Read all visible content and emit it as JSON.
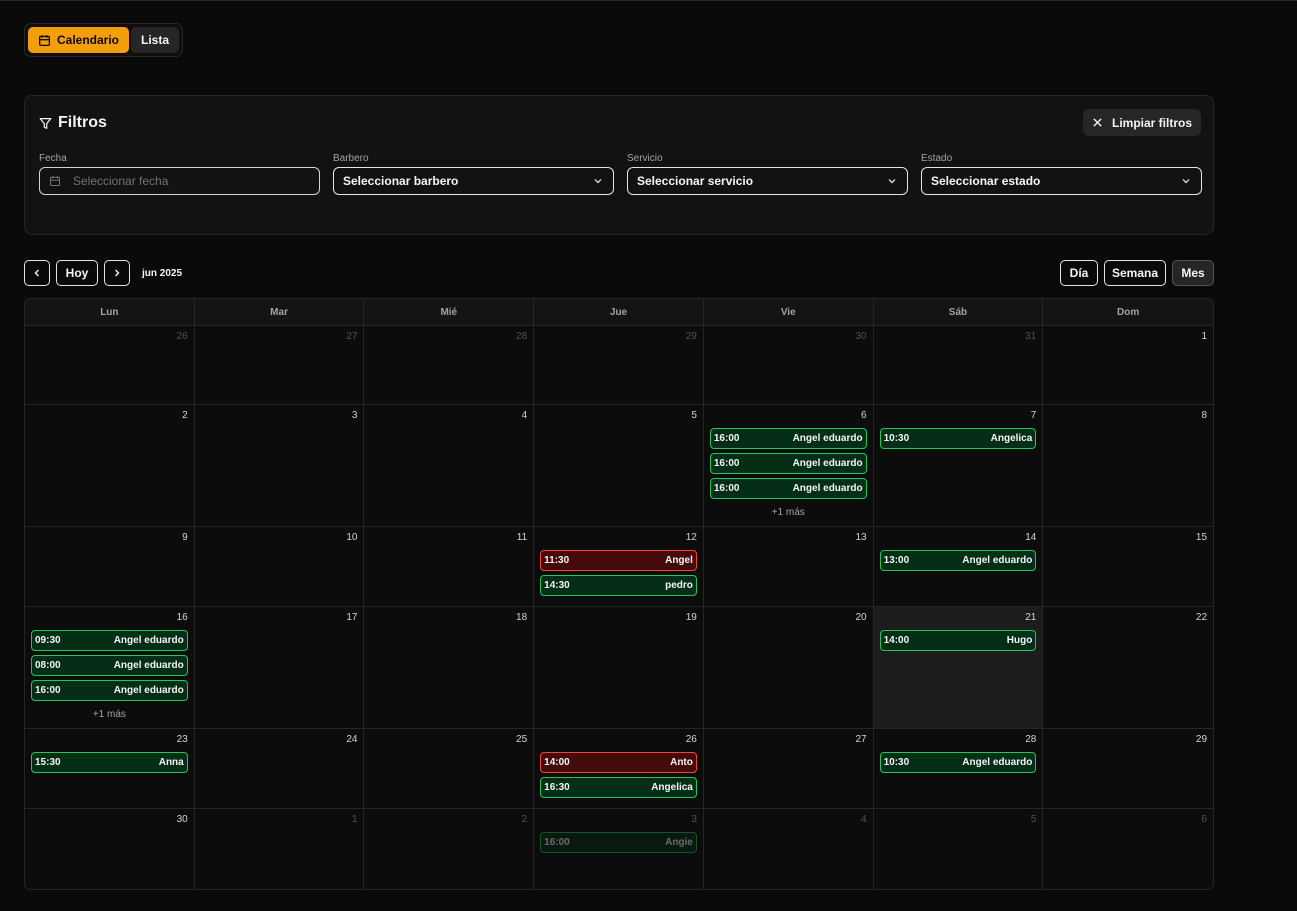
{
  "view_toggle": {
    "calendar_label": "Calendario",
    "list_label": "Lista"
  },
  "filters": {
    "title": "Filtros",
    "clear_label": "Limpiar filtros",
    "date": {
      "label": "Fecha",
      "placeholder": "Seleccionar fecha"
    },
    "barber": {
      "label": "Barbero",
      "value": "Seleccionar barbero"
    },
    "service": {
      "label": "Servicio",
      "value": "Seleccionar servicio"
    },
    "status": {
      "label": "Estado",
      "value": "Seleccionar estado"
    }
  },
  "nav": {
    "today_label": "Hoy",
    "month_label": "jun 2025",
    "views": [
      "Día",
      "Semana",
      "Mes"
    ],
    "selected_view": "Mes"
  },
  "calendar": {
    "days_of_week": [
      "Lun",
      "Mar",
      "Mié",
      "Jue",
      "Vie",
      "Sáb",
      "Dom"
    ],
    "today": 21,
    "weeks": [
      [
        {
          "n": "26",
          "other": true,
          "events": []
        },
        {
          "n": "27",
          "other": true,
          "events": []
        },
        {
          "n": "28",
          "other": true,
          "events": []
        },
        {
          "n": "29",
          "other": true,
          "events": []
        },
        {
          "n": "30",
          "other": true,
          "events": []
        },
        {
          "n": "31",
          "other": true,
          "events": []
        },
        {
          "n": "1",
          "events": []
        }
      ],
      [
        {
          "n": "2",
          "events": []
        },
        {
          "n": "3",
          "events": []
        },
        {
          "n": "4",
          "events": []
        },
        {
          "n": "5",
          "events": []
        },
        {
          "n": "6",
          "events": [
            {
              "time": "16:00",
              "name": "Angel eduardo",
              "status": "confirmed"
            },
            {
              "time": "16:00",
              "name": "Angel eduardo",
              "status": "confirmed"
            },
            {
              "time": "16:00",
              "name": "Angel eduardo",
              "status": "confirmed"
            }
          ],
          "more": "+1 más"
        },
        {
          "n": "7",
          "events": [
            {
              "time": "10:30",
              "name": "Angelica",
              "status": "confirmed"
            }
          ]
        },
        {
          "n": "8",
          "events": []
        }
      ],
      [
        {
          "n": "9",
          "events": []
        },
        {
          "n": "10",
          "events": []
        },
        {
          "n": "11",
          "events": []
        },
        {
          "n": "12",
          "events": [
            {
              "time": "11:30",
              "name": "Angel",
              "status": "cancelled"
            },
            {
              "time": "14:30",
              "name": "pedro",
              "status": "confirmed"
            }
          ]
        },
        {
          "n": "13",
          "events": []
        },
        {
          "n": "14",
          "events": [
            {
              "time": "13:00",
              "name": "Angel eduardo",
              "status": "confirmed"
            }
          ]
        },
        {
          "n": "15",
          "events": []
        }
      ],
      [
        {
          "n": "16",
          "events": [
            {
              "time": "09:30",
              "name": "Angel eduardo",
              "status": "confirmed"
            },
            {
              "time": "08:00",
              "name": "Angel eduardo",
              "status": "confirmed"
            },
            {
              "time": "16:00",
              "name": "Angel eduardo",
              "status": "confirmed"
            }
          ],
          "more": "+1 más"
        },
        {
          "n": "17",
          "events": []
        },
        {
          "n": "18",
          "events": []
        },
        {
          "n": "19",
          "events": []
        },
        {
          "n": "20",
          "events": []
        },
        {
          "n": "21",
          "today": true,
          "events": [
            {
              "time": "14:00",
              "name": "Hugo",
              "status": "confirmed"
            }
          ]
        },
        {
          "n": "22",
          "events": []
        }
      ],
      [
        {
          "n": "23",
          "events": [
            {
              "time": "15:30",
              "name": "Anna",
              "status": "confirmed"
            }
          ]
        },
        {
          "n": "24",
          "events": []
        },
        {
          "n": "25",
          "events": []
        },
        {
          "n": "26",
          "events": [
            {
              "time": "14:00",
              "name": "Anto",
              "status": "cancelled"
            },
            {
              "time": "16:30",
              "name": "Angelica",
              "status": "confirmed"
            }
          ]
        },
        {
          "n": "27",
          "events": []
        },
        {
          "n": "28",
          "events": [
            {
              "time": "10:30",
              "name": "Angel eduardo",
              "status": "confirmed"
            }
          ]
        },
        {
          "n": "29",
          "events": []
        }
      ],
      [
        {
          "n": "30",
          "events": []
        },
        {
          "n": "1",
          "other": true,
          "events": []
        },
        {
          "n": "2",
          "other": true,
          "events": []
        },
        {
          "n": "3",
          "other": true,
          "events": [
            {
              "time": "16:00",
              "name": "Angie",
              "status": "confirmed"
            }
          ]
        },
        {
          "n": "4",
          "other": true,
          "events": []
        },
        {
          "n": "5",
          "other": true,
          "events": []
        },
        {
          "n": "6",
          "other": true,
          "events": []
        }
      ]
    ]
  },
  "colors": {
    "accent": "#f59e0b",
    "confirmed_border": "#22c55e",
    "confirmed_bg": "#052e16",
    "cancelled_border": "#ef4444",
    "cancelled_bg": "#450a0a"
  }
}
